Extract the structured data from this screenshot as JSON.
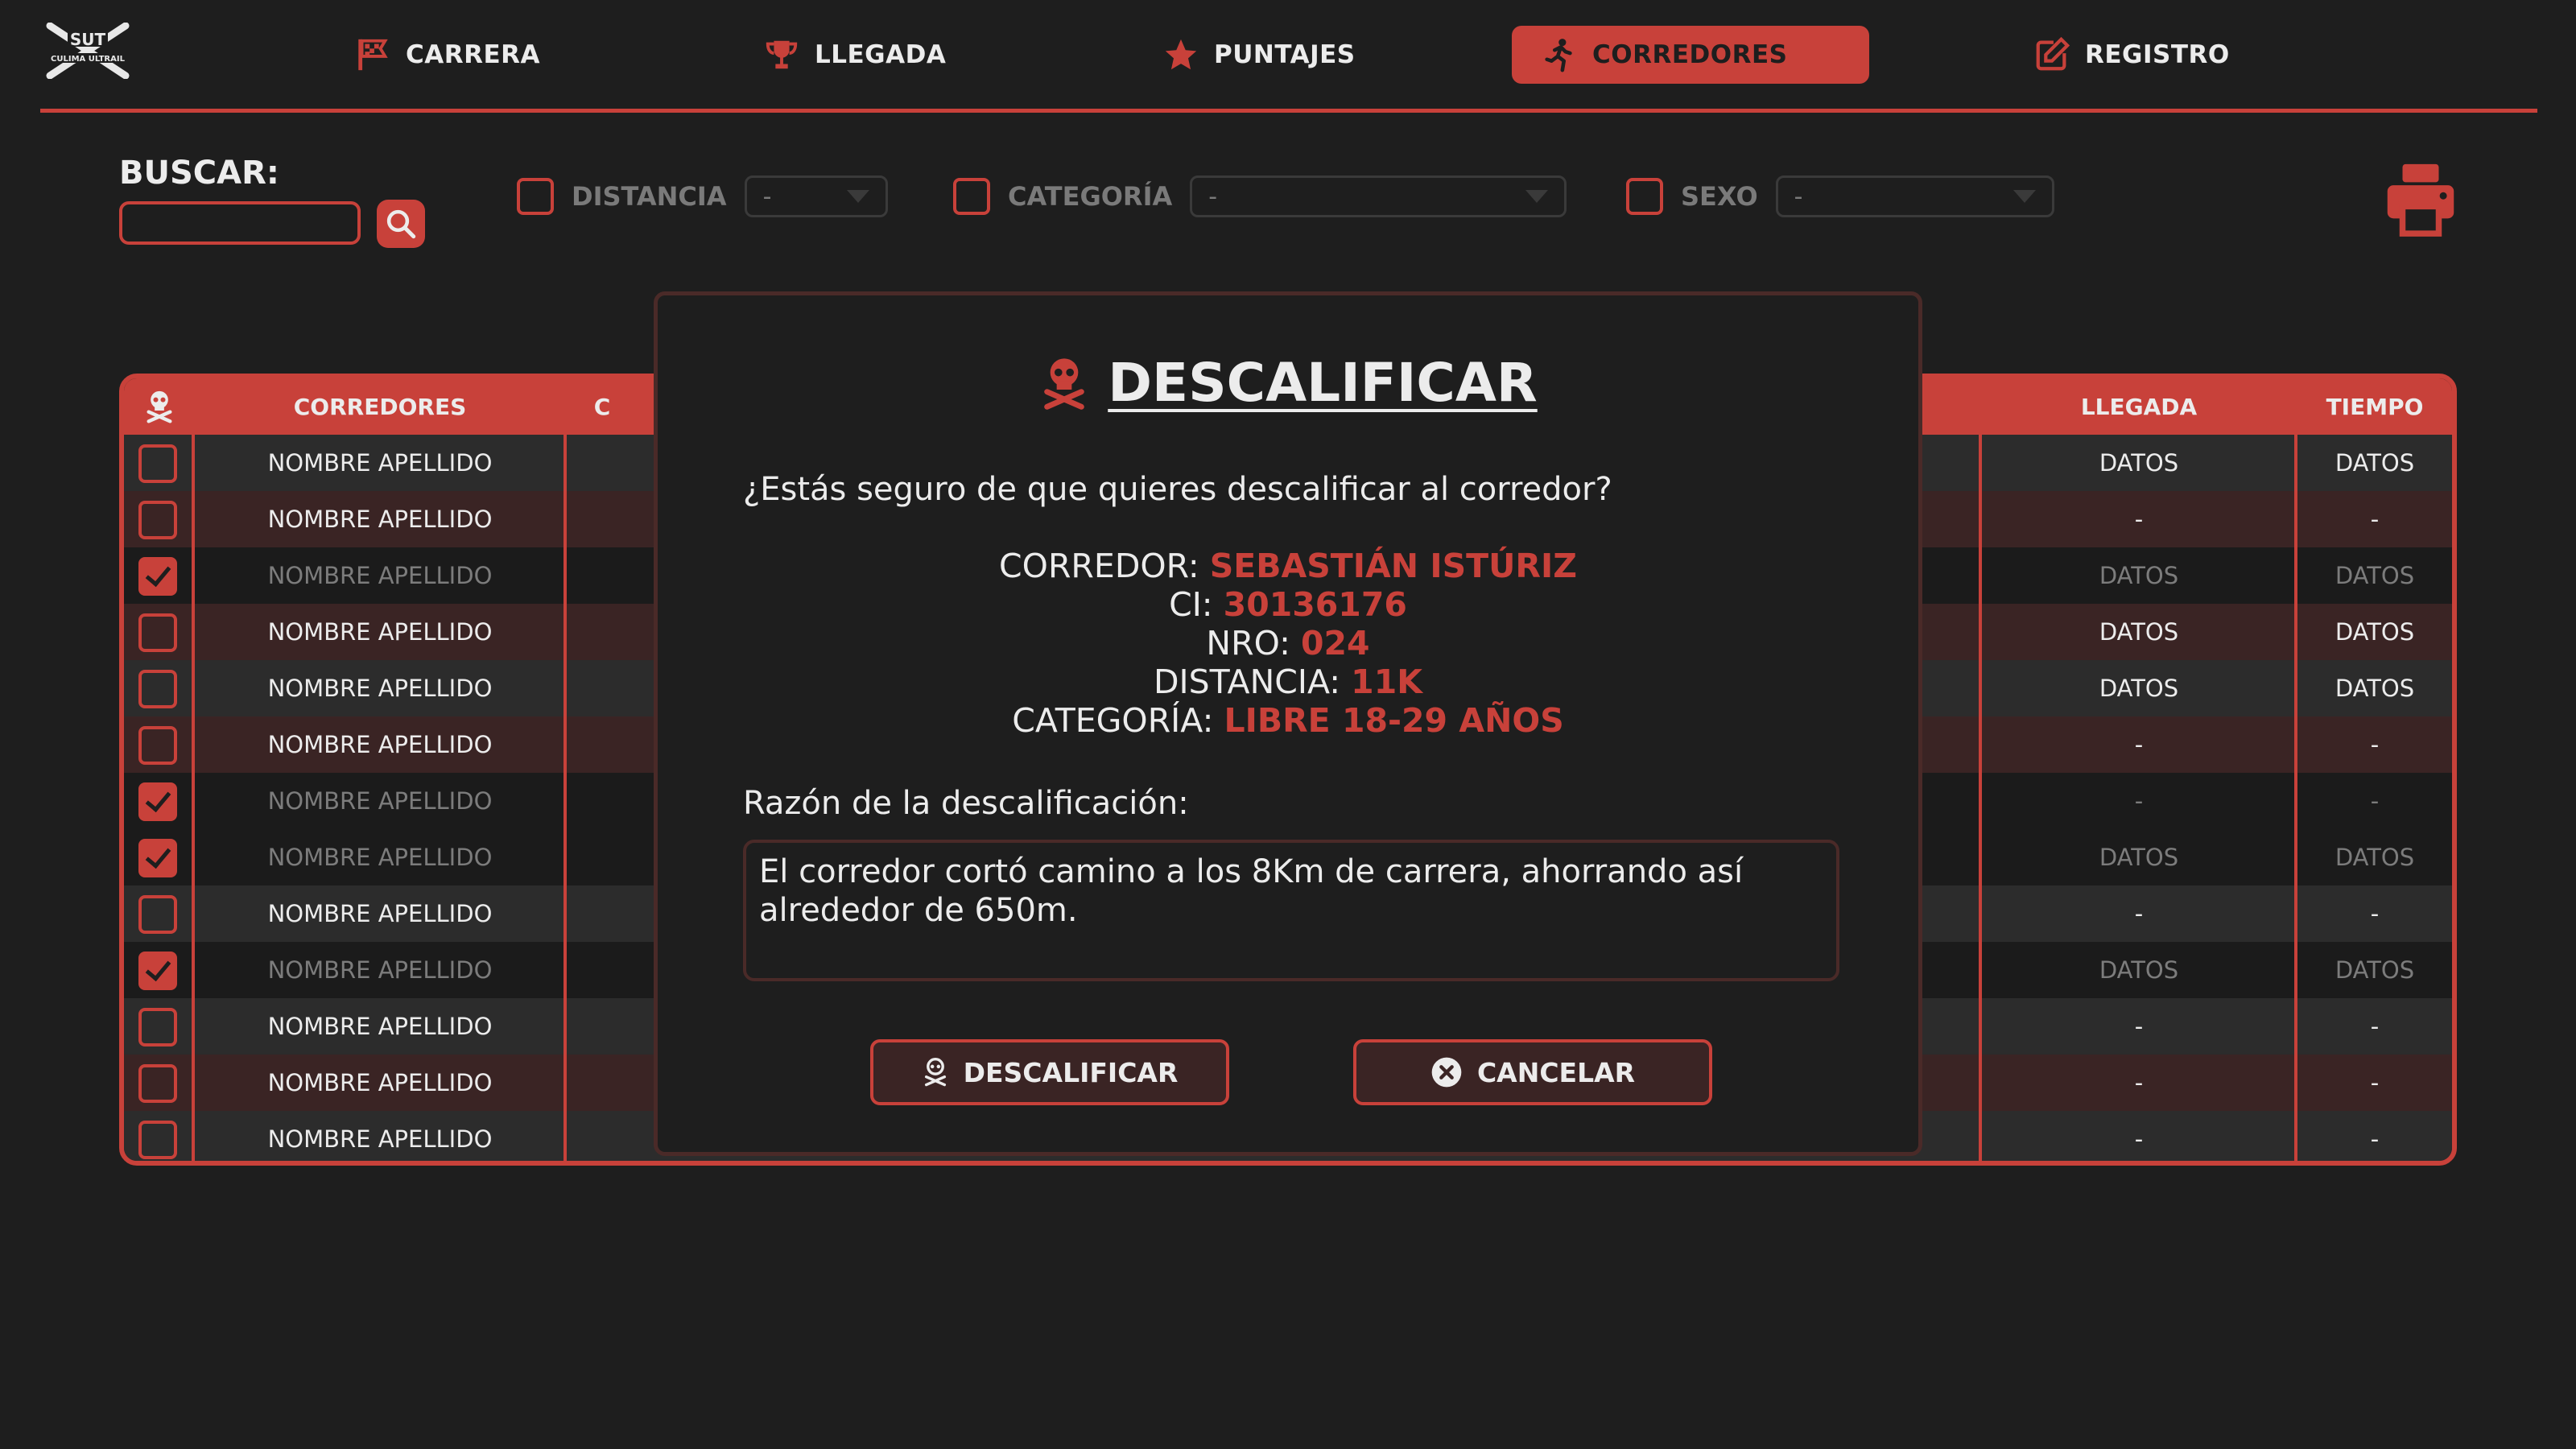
{
  "nav": {
    "items": [
      {
        "label": "CARRERA",
        "icon": "flag-icon"
      },
      {
        "label": "LLEGADA",
        "icon": "trophy-icon"
      },
      {
        "label": "PUNTAJES",
        "icon": "star-icon"
      },
      {
        "label": "CORREDORES",
        "icon": "runner-icon",
        "active": true
      },
      {
        "label": "REGISTRO",
        "icon": "edit-icon"
      }
    ],
    "logo_text": "SUT",
    "logo_subtext": "CULIMA ULTRAIL"
  },
  "filters": {
    "search_label": "BUSCAR:",
    "search_value": "",
    "distance": {
      "label": "DISTANCIA",
      "value": "-"
    },
    "category": {
      "label": "CATEGORÍA",
      "value": "-"
    },
    "sex": {
      "label": "SEXO",
      "value": "-"
    }
  },
  "table": {
    "headers": {
      "runners": "CORREDORES",
      "col2": "C",
      "arrival": "LLEGADA",
      "time": "TIEMPO"
    },
    "rows": [
      {
        "name": "NOMBRE APELLIDO",
        "arrival": "DATOS",
        "time": "DATOS",
        "checked": false
      },
      {
        "name": "NOMBRE APELLIDO",
        "arrival": "-",
        "time": "-",
        "checked": false
      },
      {
        "name": "NOMBRE APELLIDO",
        "arrival": "DATOS",
        "time": "DATOS",
        "checked": true
      },
      {
        "name": "NOMBRE APELLIDO",
        "arrival": "DATOS",
        "time": "DATOS",
        "checked": false
      },
      {
        "name": "NOMBRE APELLIDO",
        "arrival": "DATOS",
        "time": "DATOS",
        "checked": false
      },
      {
        "name": "NOMBRE APELLIDO",
        "arrival": "-",
        "time": "-",
        "checked": false
      },
      {
        "name": "NOMBRE APELLIDO",
        "arrival": "-",
        "time": "-",
        "checked": true
      },
      {
        "name": "NOMBRE APELLIDO",
        "arrival": "DATOS",
        "time": "DATOS",
        "checked": true
      },
      {
        "name": "NOMBRE APELLIDO",
        "arrival": "-",
        "time": "-",
        "checked": false
      },
      {
        "name": "NOMBRE APELLIDO",
        "arrival": "DATOS",
        "time": "DATOS",
        "checked": true
      },
      {
        "name": "NOMBRE APELLIDO",
        "arrival": "-",
        "time": "-",
        "checked": false
      },
      {
        "name": "NOMBRE APELLIDO",
        "arrival": "-",
        "time": "-",
        "checked": false
      },
      {
        "name": "NOMBRE APELLIDO",
        "arrival": "-",
        "time": "-",
        "checked": false
      }
    ]
  },
  "modal": {
    "title": "DESCALIFICAR",
    "question": "¿Estás seguro de que quieres descalificar al corredor?",
    "runner_label": "CORREDOR:",
    "runner_value": "SEBASTIÁN ISTÚRIZ",
    "ci_label": "CI:",
    "ci_value": "30136176",
    "nro_label": "NRO:",
    "nro_value": "024",
    "distance_label": "DISTANCIA:",
    "distance_value": "11K",
    "category_label": "CATEGORÍA:",
    "category_value": "LIBRE 18-29 AÑOS",
    "reason_label": "Razón de la descalificación:",
    "reason_text": "El corredor cortó camino a los 8Km de carrera, ahorrando así alrededor de 650m.",
    "confirm_label": "DESCALIFICAR",
    "cancel_label": "CANCELAR"
  },
  "colors": {
    "accent": "#c8413a",
    "background": "#1e1e1e"
  }
}
